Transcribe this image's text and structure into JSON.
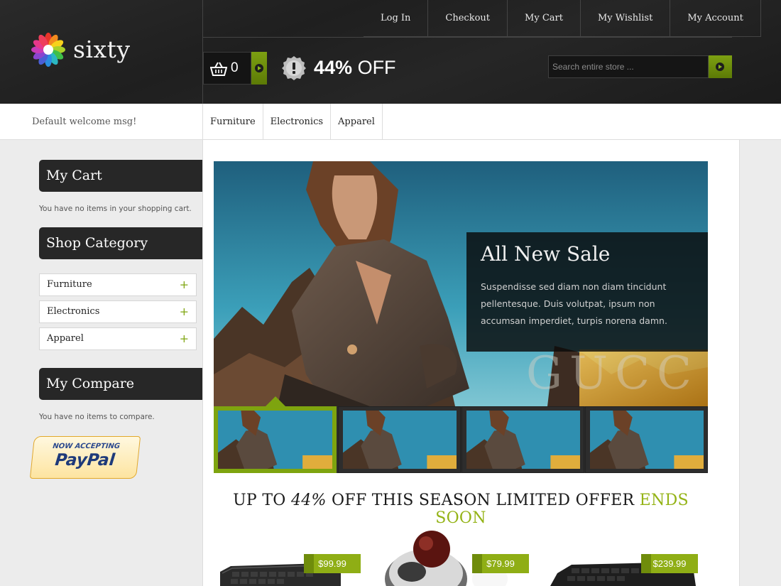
{
  "brand": {
    "name": "sixty"
  },
  "top_links": [
    "Log In",
    "Checkout",
    "My Cart",
    "My Wishlist",
    "My Account"
  ],
  "cart": {
    "count": "0"
  },
  "offer": {
    "percent": "44%",
    "text": "OFF"
  },
  "search": {
    "placeholder": "Search entire store ..."
  },
  "welcome": "Default welcome msg!",
  "main_menu": [
    "Furniture",
    "Electronics",
    "Apparel"
  ],
  "sidebar": {
    "cart_title": "My Cart",
    "cart_empty": "You have no items in your shopping cart.",
    "category_title": "Shop Category",
    "categories": [
      "Furniture",
      "Electronics",
      "Apparel"
    ],
    "compare_title": "My Compare",
    "compare_empty": "You have no items to compare.",
    "paypal_top": "NOW ACCEPTING",
    "paypal_brand": "PayPal"
  },
  "hero": {
    "title": "All New Sale",
    "body": "Suspendisse sed diam non diam tincidunt pellentesque. Duis volutpat, ipsum non accumsan imperdiet, turpis norena damn.",
    "watermark": "GUCC"
  },
  "promo": {
    "part1": "UP TO ",
    "percent": "44%",
    "part2": " OFF THIS SEASON LIMITED OFFER ",
    "highlight": "ENDS SOON"
  },
  "products": [
    {
      "price": "$99.99"
    },
    {
      "price": "$79.99"
    },
    {
      "price": "$239.99"
    }
  ],
  "colors": {
    "accent": "#8fae15",
    "dark": "#272727"
  }
}
